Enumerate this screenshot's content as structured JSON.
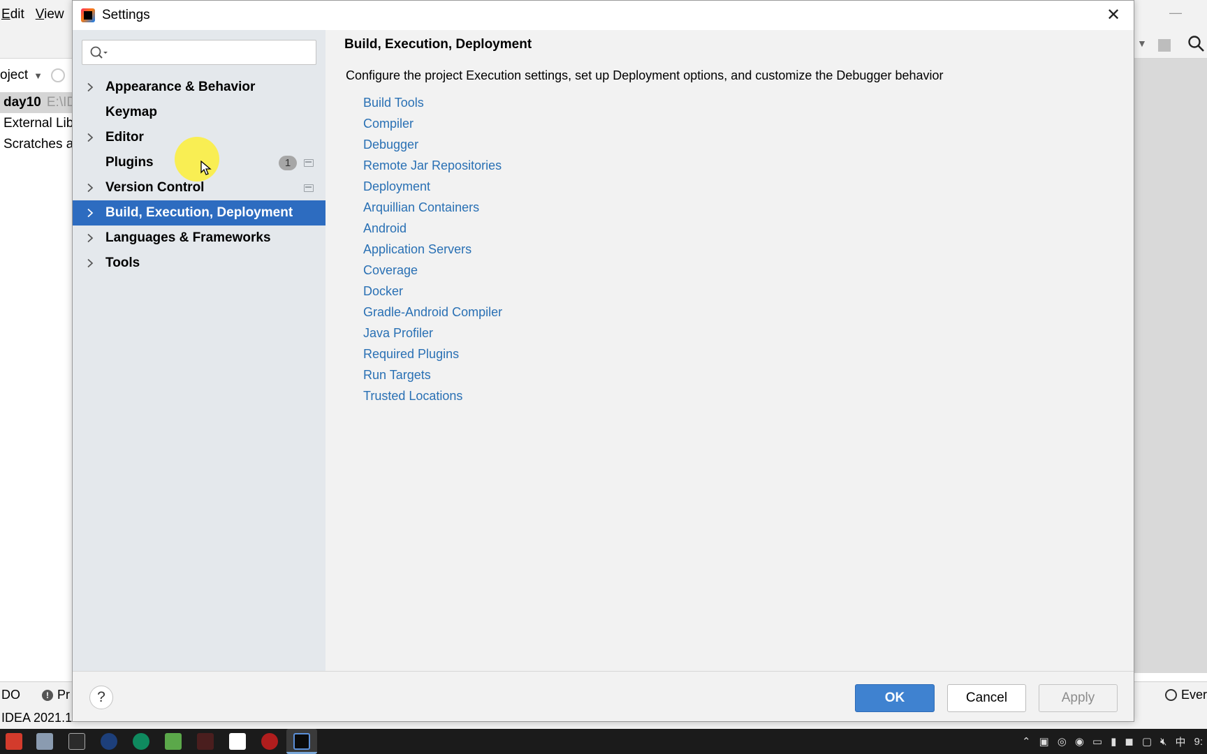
{
  "ide": {
    "menu": [
      {
        "label": "Edit",
        "mnemonic": "E",
        "rest": "dit"
      },
      {
        "label": "View",
        "mnemonic": "V",
        "rest": "iew"
      }
    ],
    "project_label": "oject",
    "tree": [
      {
        "label": "day10",
        "path": "E:\\ID"
      },
      {
        "label": "External Lib"
      },
      {
        "label": "Scratches a"
      }
    ],
    "status": {
      "todo": "DO",
      "problems": "Pr",
      "events": "Ever"
    },
    "info": "IDEA 2021.1"
  },
  "taskbar": {
    "tray_lang": "中",
    "tray_time": "9:"
  },
  "dialog": {
    "title": "Settings",
    "search": {
      "value": "",
      "placeholder": ""
    },
    "nav": [
      {
        "label": "Appearance & Behavior",
        "expandable": true
      },
      {
        "label": "Keymap",
        "expandable": false
      },
      {
        "label": "Editor",
        "expandable": true
      },
      {
        "label": "Plugins",
        "expandable": false,
        "badge": "1",
        "project_icon": true
      },
      {
        "label": "Version Control",
        "expandable": true,
        "project_icon": true
      },
      {
        "label": "Build, Execution, Deployment",
        "expandable": true,
        "selected": true
      },
      {
        "label": "Languages & Frameworks",
        "expandable": true
      },
      {
        "label": "Tools",
        "expandable": true
      }
    ],
    "content": {
      "title": "Build, Execution, Deployment",
      "description": "Configure the project Execution settings, set up Deployment options, and customize the Debugger behavior",
      "links": [
        "Build Tools",
        "Compiler",
        "Debugger",
        "Remote Jar Repositories",
        "Deployment",
        "Arquillian Containers",
        "Android",
        "Application Servers",
        "Coverage",
        "Docker",
        "Gradle-Android Compiler",
        "Java Profiler",
        "Required Plugins",
        "Run Targets",
        "Trusted Locations"
      ]
    },
    "buttons": {
      "help": "?",
      "ok": "OK",
      "cancel": "Cancel",
      "apply": "Apply"
    }
  },
  "colors": {
    "selection": "#2d6cc0",
    "link": "#2970b4",
    "ok_button": "#3f82d0",
    "left_panel": "#e4e8ec"
  }
}
